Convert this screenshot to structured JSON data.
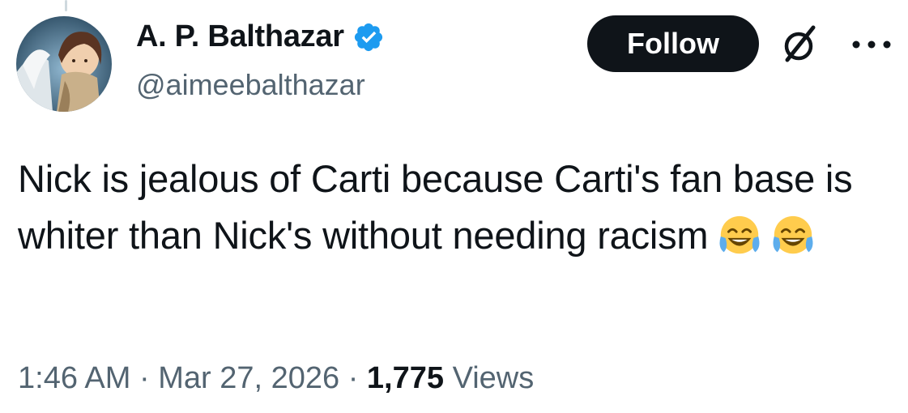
{
  "author": {
    "display_name": "A. P. Balthazar",
    "handle": "@aimeebalthazar",
    "verified": true
  },
  "header": {
    "follow_label": "Follow",
    "icons": [
      "grok-icon",
      "more-icon"
    ]
  },
  "tweet": {
    "text": "Nick is jealous of Carti because Carti's fan base is whiter than Nick's without needing racism",
    "emojis": [
      "face-with-tears-of-joy",
      "face-with-tears-of-joy"
    ]
  },
  "meta": {
    "time": "1:46 AM",
    "separator": "·",
    "date": "Mar 27, 2026",
    "views_count": "1,775",
    "views_label": "Views"
  },
  "colors": {
    "text": "#0f1419",
    "secondary": "#536471",
    "verified_blue": "#1d9bf0",
    "button_bg": "#0f1419"
  }
}
